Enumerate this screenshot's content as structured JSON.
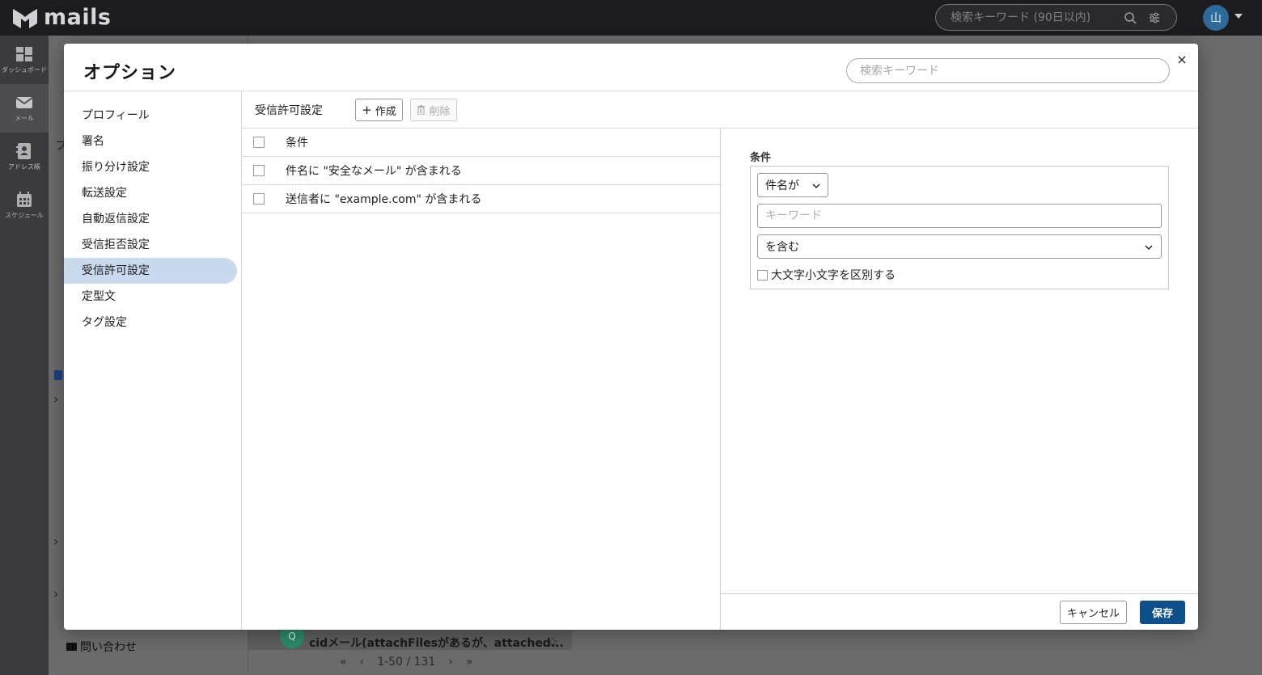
{
  "app": {
    "name": "mails",
    "search_placeholder": "検索キーワード (90日以内)",
    "user_initial": "山"
  },
  "rail": {
    "items": [
      {
        "label": "ダッシュボード",
        "icon": "dashboard-icon"
      },
      {
        "label": "メール",
        "icon": "mail-icon"
      },
      {
        "label": "アドレス帳",
        "icon": "address-book-icon"
      },
      {
        "label": "スケジュール",
        "icon": "calendar-icon"
      }
    ]
  },
  "background": {
    "folder_label": "問い合わせ",
    "avatar_initial": "Q",
    "mail_subject": "cidメール(attachFilesがあるが、attached...",
    "pager_text": "1-50 / 131",
    "left_letter": "フ"
  },
  "dialog": {
    "title": "オプション",
    "search_placeholder": "検索キーワード",
    "close_symbol": "×",
    "menu": [
      "プロフィール",
      "署名",
      "振り分け設定",
      "転送設定",
      "自動返信設定",
      "受信拒否設定",
      "受信許可設定",
      "定型文",
      "タグ設定"
    ],
    "active_menu_index": 6,
    "section_title": "受信許可設定",
    "create_label": "作成",
    "delete_label": "削除",
    "list_header": "条件",
    "rules": [
      "件名に \"安全なメール\" が含まれる",
      "送信者に \"example.com\" が含まれる"
    ],
    "detail": {
      "label": "条件",
      "field_select": "件名が",
      "keyword_placeholder": "キーワード",
      "match_select": "を含む",
      "case_label": "大文字小文字を区別する"
    },
    "cancel_label": "キャンセル",
    "save_label": "保存"
  },
  "colors": {
    "accent": "#0d4f8b",
    "active_menu": "#c9daee",
    "topbar": "#1c1c1e"
  }
}
